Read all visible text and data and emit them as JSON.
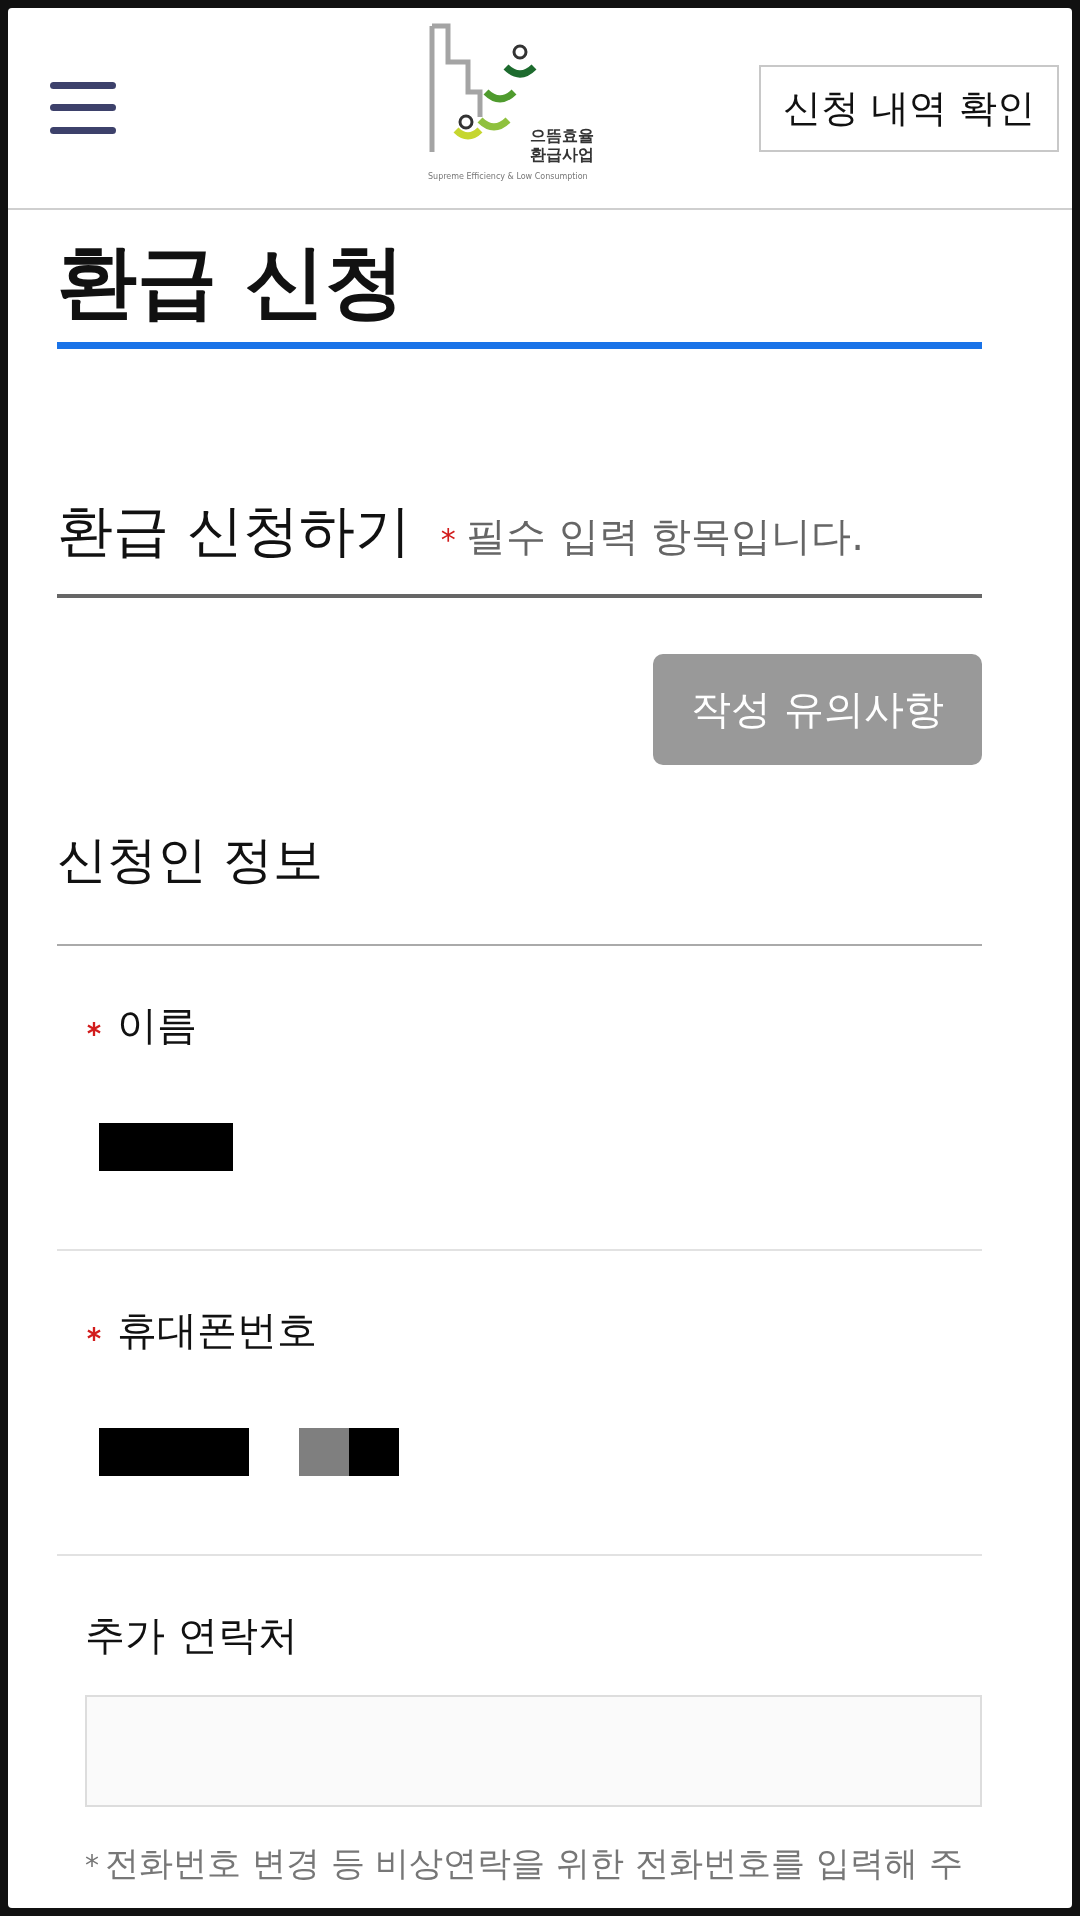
{
  "header": {
    "logo": {
      "name": "으뜸효율",
      "name2": "환급사업",
      "tagline": "Supreme Efficiency & Low Consumption"
    },
    "history_button": "신청 내역 확인"
  },
  "page_title": "환급 신청",
  "section": {
    "title": "환급 신청하기",
    "required_mark": "*",
    "required_note": "필수 입력 항목입니다.",
    "notice_button": "작성 유의사항"
  },
  "applicant": {
    "title": "신청인 정보",
    "fields": [
      {
        "kind": "redacted",
        "label": "이름",
        "required": true,
        "redacted_groups": [
          [
            {
              "color": "#000000"
            }
          ]
        ]
      },
      {
        "kind": "redacted",
        "label": "휴대폰번호",
        "required": true,
        "redacted_groups": [
          [
            {
              "color": "#000000"
            }
          ],
          [
            {
              "color": "#7f7f7f"
            },
            {
              "color": "#000000"
            }
          ]
        ]
      },
      {
        "kind": "input",
        "label": "추가 연락처",
        "required": false,
        "note_mark": "*",
        "note": "전화번호 변경 등 비상연락을 위한 전화번호를 입력해 주"
      }
    ]
  }
}
